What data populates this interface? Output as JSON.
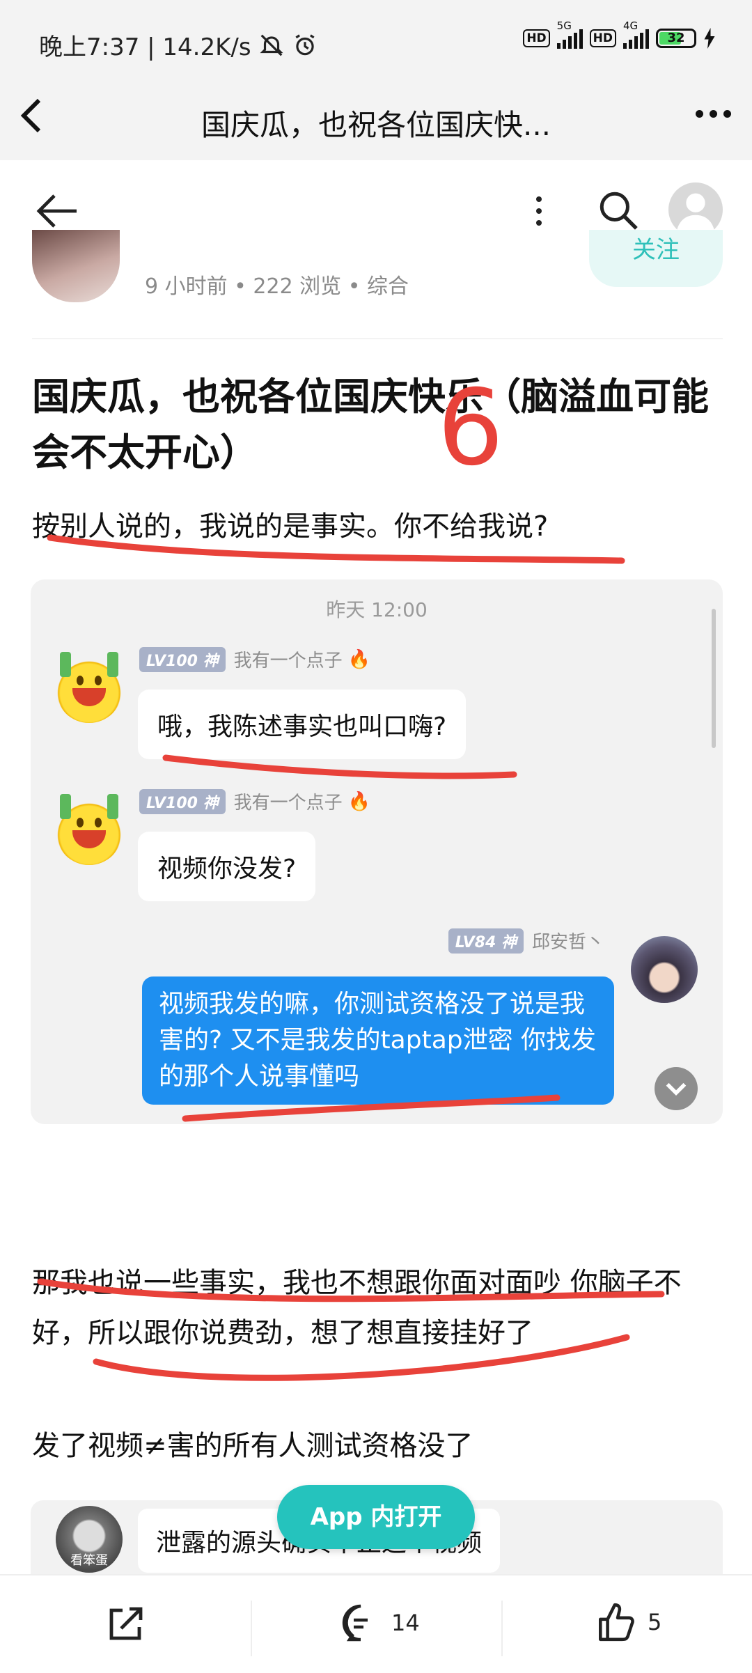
{
  "status_bar": {
    "time_speed": "晚上7:37 | 14.2K/s",
    "hd_label": "HD",
    "net1": "5G",
    "net2": "4G",
    "battery": "32"
  },
  "browser": {
    "title": "国庆瓜，也祝各位国庆快..."
  },
  "post": {
    "meta": "9 小时前 • 222 浏览 • 综合",
    "follow_label": "关注",
    "title": "国庆瓜，也祝各位国庆快乐（脑溢血可能会不太开心）",
    "annotation_mark": "6",
    "para1": "按别人说的，我说的是事实。你不给我说?",
    "para2": "那我也说一些事实，我也不想跟你面对面吵 你脑子不好，所以跟你说费劲，想了想直接挂好了",
    "para3": "发了视频≠害的所有人测试资格没了"
  },
  "chat": {
    "time": "昨天 12:00",
    "messages": [
      {
        "level": "LV100 神",
        "user": "我有一个点子",
        "text": "哦，我陈述事实也叫口嗨?"
      },
      {
        "level": "LV100 神",
        "user": "我有一个点子",
        "text": "视频你没发?"
      },
      {
        "level": "LV84 神",
        "user": "邱安哲丶",
        "text": "视频我发的嘛，你测试资格没了说是我害的? 又不是我发的taptap泄密 你找发的那个人说事懂吗"
      }
    ]
  },
  "quote": {
    "avatar_label": "看笨蛋",
    "text": "泄露的源头确实不止这个视频"
  },
  "app_open_label": "App 内打开",
  "bottom_bar": {
    "comment_count": "14",
    "like_count": "5"
  },
  "colors": {
    "accent_teal": "#25c3bd",
    "chat_blue": "#1e8ff0",
    "annotation_red": "#e8423a"
  }
}
